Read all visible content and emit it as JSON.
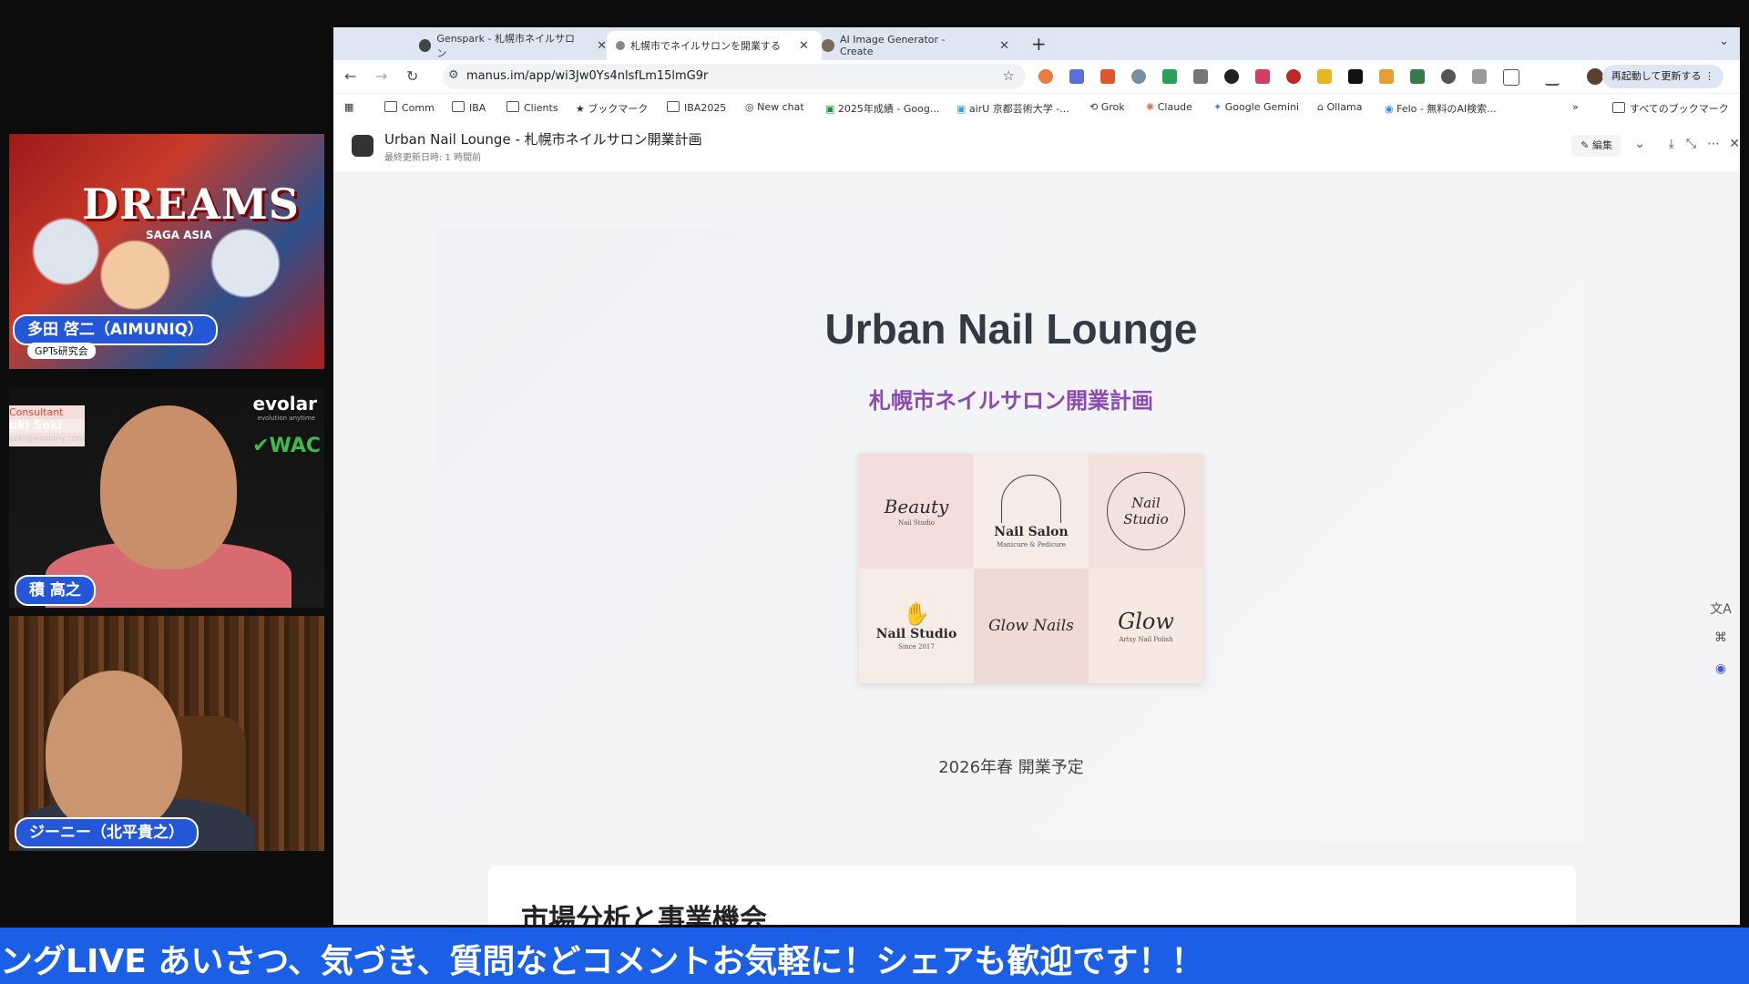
{
  "participants": [
    {
      "name": "多田 啓二（AIMUNIQ）",
      "badge": "GPTs研究会",
      "banner": "DREAMS",
      "banner_sub": "SAGA ASIA"
    },
    {
      "name": "積 高之",
      "title": "Consultant",
      "person": "uki Seki",
      "email": "seki@evolany.com",
      "brand": "evolar",
      "brand_sub": "evolution anytime",
      "brand2": "WAC"
    },
    {
      "name": "ジーニー（北平貴之）"
    }
  ],
  "browser": {
    "tabs": [
      {
        "label": "Genspark - 札幌市ネイルサロン",
        "active": false
      },
      {
        "label": "札幌市でネイルサロンを開業する",
        "active": true
      },
      {
        "label": "AI Image Generator - Create",
        "active": false
      }
    ],
    "new_tab": "+",
    "url": "manus.im/app/wi3Jw0Ys4nlsfLm15lmG9r",
    "relaunch_label": "再起動して更新する",
    "bookmarks": [
      "Comm",
      "IBA",
      "Clients",
      "ブックマーク",
      "IBA2025",
      "New chat",
      "2025年成績 - Goog...",
      "airU 京都芸術大学 -...",
      "Grok",
      "Claude",
      "Google Gemini",
      "Ollama",
      "Felo - 無料のAI検索..."
    ],
    "bookmarks_all": "すべてのブックマーク"
  },
  "app": {
    "title": "Urban Nail Lounge - 札幌市ネイルサロン開業計画",
    "updated": "最終更新日時: 1 時間前",
    "edit_label": "編集"
  },
  "hero": {
    "title": "Urban Nail Lounge",
    "subtitle": "札幌市ネイルサロン開業計画",
    "logos": [
      {
        "main": "Beauty",
        "small": "Nail Studio"
      },
      {
        "main": "Nail Salon",
        "small": "Manicure & Pedicure"
      },
      {
        "main": "Nail Studio",
        "small": ""
      },
      {
        "main": "Nail Studio",
        "small": "Since 2017"
      },
      {
        "main": "Glow Nails",
        "small": ""
      },
      {
        "main": "Glow",
        "small": "Artsy Nail Polish"
      }
    ],
    "date": "2026年春 開業予定"
  },
  "section": {
    "title": "市場分析と事業機会"
  },
  "ticker": "ングLIVE あいさつ、気づき、質問などコメントお気軽に！シェアも歓迎です！！"
}
